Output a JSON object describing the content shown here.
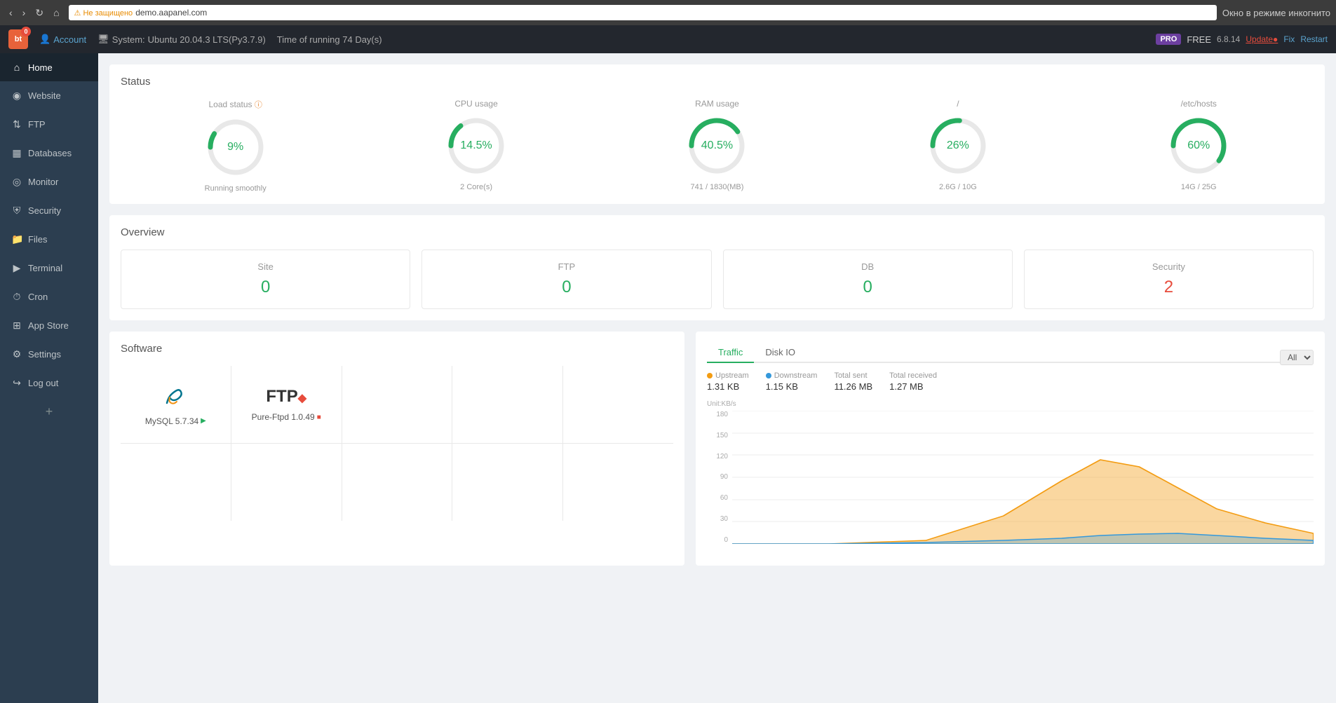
{
  "browser": {
    "url": "demo.aapanel.com",
    "warning": "⚠ Не защищено",
    "incognito": "Окно в режиме инкогнито"
  },
  "topbar": {
    "logo": "bt",
    "badge": "0",
    "account_label": "Account",
    "system_label": "System:",
    "system_value": "Ubuntu 20.04.3 LTS(Py3.7.9)",
    "runtime_label": "Time of running 74 Day(s)",
    "pro_badge": "PRO",
    "free_label": "FREE",
    "version": "6.8.14",
    "update_label": "Update●",
    "fix_label": "Fix",
    "restart_label": "Restart"
  },
  "sidebar": {
    "items": [
      {
        "id": "home",
        "label": "Home",
        "icon": "⌂",
        "active": true
      },
      {
        "id": "website",
        "label": "Website",
        "icon": "◉"
      },
      {
        "id": "ftp",
        "label": "FTP",
        "icon": "⇅"
      },
      {
        "id": "databases",
        "label": "Databases",
        "icon": "▦"
      },
      {
        "id": "monitor",
        "label": "Monitor",
        "icon": "◎"
      },
      {
        "id": "security",
        "label": "Security",
        "icon": "⛨"
      },
      {
        "id": "files",
        "label": "Files",
        "icon": "📁"
      },
      {
        "id": "terminal",
        "label": "Terminal",
        "icon": "▶"
      },
      {
        "id": "cron",
        "label": "Cron",
        "icon": "⏱"
      },
      {
        "id": "appstore",
        "label": "App Store",
        "icon": "⊞"
      },
      {
        "id": "settings",
        "label": "Settings",
        "icon": "⚙"
      },
      {
        "id": "logout",
        "label": "Log out",
        "icon": "↪"
      }
    ],
    "add_label": "+"
  },
  "status": {
    "title": "Status",
    "gauges": [
      {
        "id": "load",
        "label": "Load status",
        "value": "9%",
        "sublabel": "Running smoothly",
        "percent": 9,
        "color": "#27ae60"
      },
      {
        "id": "cpu",
        "label": "CPU usage",
        "value": "14.5%",
        "sublabel": "2 Core(s)",
        "percent": 14.5,
        "color": "#27ae60"
      },
      {
        "id": "ram",
        "label": "RAM usage",
        "value": "40.5%",
        "sublabel": "741 / 1830(MB)",
        "percent": 40.5,
        "color": "#27ae60"
      },
      {
        "id": "disk1",
        "label": "/",
        "value": "26%",
        "sublabel": "2.6G / 10G",
        "percent": 26,
        "color": "#27ae60"
      },
      {
        "id": "disk2",
        "label": "/etc/hosts",
        "value": "60%",
        "sublabel": "14G / 25G",
        "percent": 60,
        "color": "#27ae60"
      }
    ]
  },
  "overview": {
    "title": "Overview",
    "cards": [
      {
        "label": "Site",
        "value": "0",
        "color": "green"
      },
      {
        "label": "FTP",
        "value": "0",
        "color": "green"
      },
      {
        "label": "DB",
        "value": "0",
        "color": "green"
      },
      {
        "label": "Security",
        "value": "2",
        "color": "red"
      }
    ]
  },
  "software": {
    "title": "Software",
    "items": [
      {
        "name": "MySQL 5.7.34",
        "icon": "mysql",
        "indicator": "▶",
        "indicator_color": "green"
      },
      {
        "name": "Pure-Ftpd 1.0.49",
        "icon": "ftp",
        "indicator": "■",
        "indicator_color": "red"
      }
    ]
  },
  "traffic": {
    "tabs": [
      {
        "label": "Traffic",
        "active": true
      },
      {
        "label": "Disk IO",
        "active": false
      }
    ],
    "select_options": [
      "All"
    ],
    "selected": "All",
    "stats": [
      {
        "label": "Upstream",
        "value": "1.31 KB",
        "dot": "orange"
      },
      {
        "label": "Downstream",
        "value": "1.15 KB",
        "dot": "blue"
      },
      {
        "label": "Total sent",
        "value": "11.26 MB"
      },
      {
        "label": "Total received",
        "value": "1.27 MB"
      }
    ],
    "chart": {
      "unit": "Unit:KB/s",
      "y_labels": [
        "180",
        "150",
        "120",
        "90",
        "60",
        "30",
        "0"
      ]
    }
  }
}
